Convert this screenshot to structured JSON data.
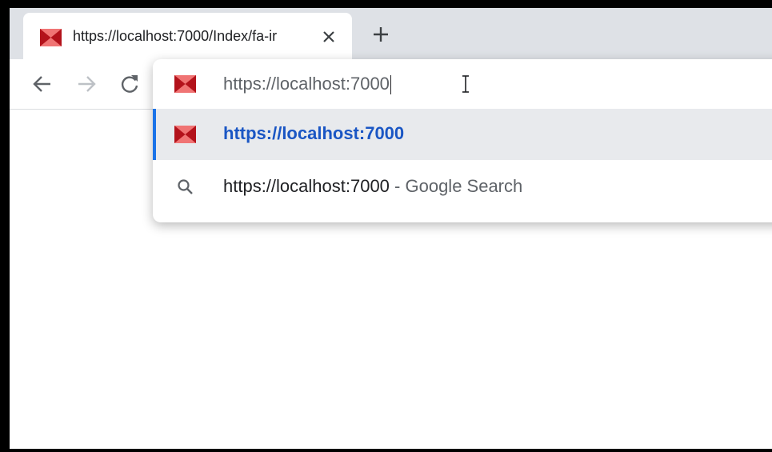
{
  "tab": {
    "title": "https://localhost:7000/Index/fa-ir",
    "favicon_icon": "bowtie-favicon-icon",
    "close_icon": "close-icon"
  },
  "new_tab_icon": "plus-icon",
  "toolbar": {
    "back_icon": "arrow-left-icon",
    "forward_icon": "arrow-right-icon",
    "reload_icon": "reload-icon"
  },
  "omnibox": {
    "input_value": "https://localhost:7000"
  },
  "suggestions": [
    {
      "text": "https://localhost:7000",
      "icon": "bowtie-favicon-icon",
      "selected": true
    },
    {
      "text": "https://localhost:7000",
      "separator": " - ",
      "description": "Google Search",
      "icon": "search-icon",
      "selected": false
    }
  ],
  "colors": {
    "favicon_dark": "#b3121b",
    "favicon_light": "#f07474",
    "link_blue": "#1a56c4",
    "accent_blue": "#1a73e8",
    "selected_row": "#e8eaed",
    "tabstrip": "#dee1e6"
  }
}
